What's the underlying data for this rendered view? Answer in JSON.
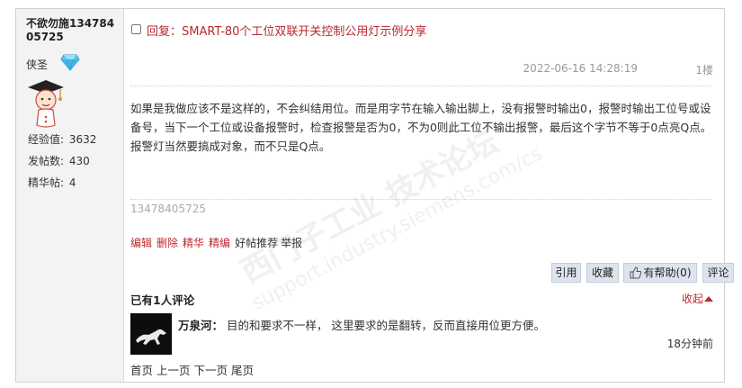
{
  "user": {
    "name": "不欲勿施13478405725",
    "rank": "侠圣",
    "stats": [
      {
        "label": "经验值:",
        "value": "3632"
      },
      {
        "label": "发帖数:",
        "value": "430"
      },
      {
        "label": "精华帖:",
        "value": "4"
      }
    ]
  },
  "post": {
    "title": "回复：SMART-80个工位双联开关控制公用灯示例分享",
    "date": "2022-06-16 14:28:19",
    "floor": "1楼",
    "content": "如果是我做应该不是这样的，不会纠结用位。而是用字节在输入输出脚上，没有报警时输出0，报警时输出工位号或设备号，当下一个工位或设备报警时，检查报警是否为0，不为0则此工位不输出报警，最后这个字节不等于0点亮Q点。报警灯当然要搞成对象，而不只是Q点。",
    "signature": "13478405725"
  },
  "actions": {
    "edit": "编辑",
    "delete": "删除",
    "essence": "精华",
    "fine_edit": "精编",
    "recommend": "好帖推荐",
    "report": "举报"
  },
  "buttons": {
    "quote": "引用",
    "favorite": "收藏",
    "helpful": "有帮助(0)",
    "comment": "评论"
  },
  "comments": {
    "header": "已有1人评论",
    "collapse": "收起",
    "items": [
      {
        "user": "万泉河：",
        "text": "目的和要求不一样， 这里要求的是翻转，反而直接用位更方便。",
        "time": "18分钟前"
      }
    ]
  },
  "pager": {
    "first": "首页",
    "prev": "上一页",
    "next": "下一页",
    "last": "尾页"
  },
  "watermark": {
    "line1": "西门子工业 技术论坛",
    "line2": "support.industry.siemens.com/cs"
  },
  "colors": {
    "accent_red": "#b8282e",
    "button_bg": "#dde4ee",
    "sidebar_bg": "#f3f3f3"
  }
}
